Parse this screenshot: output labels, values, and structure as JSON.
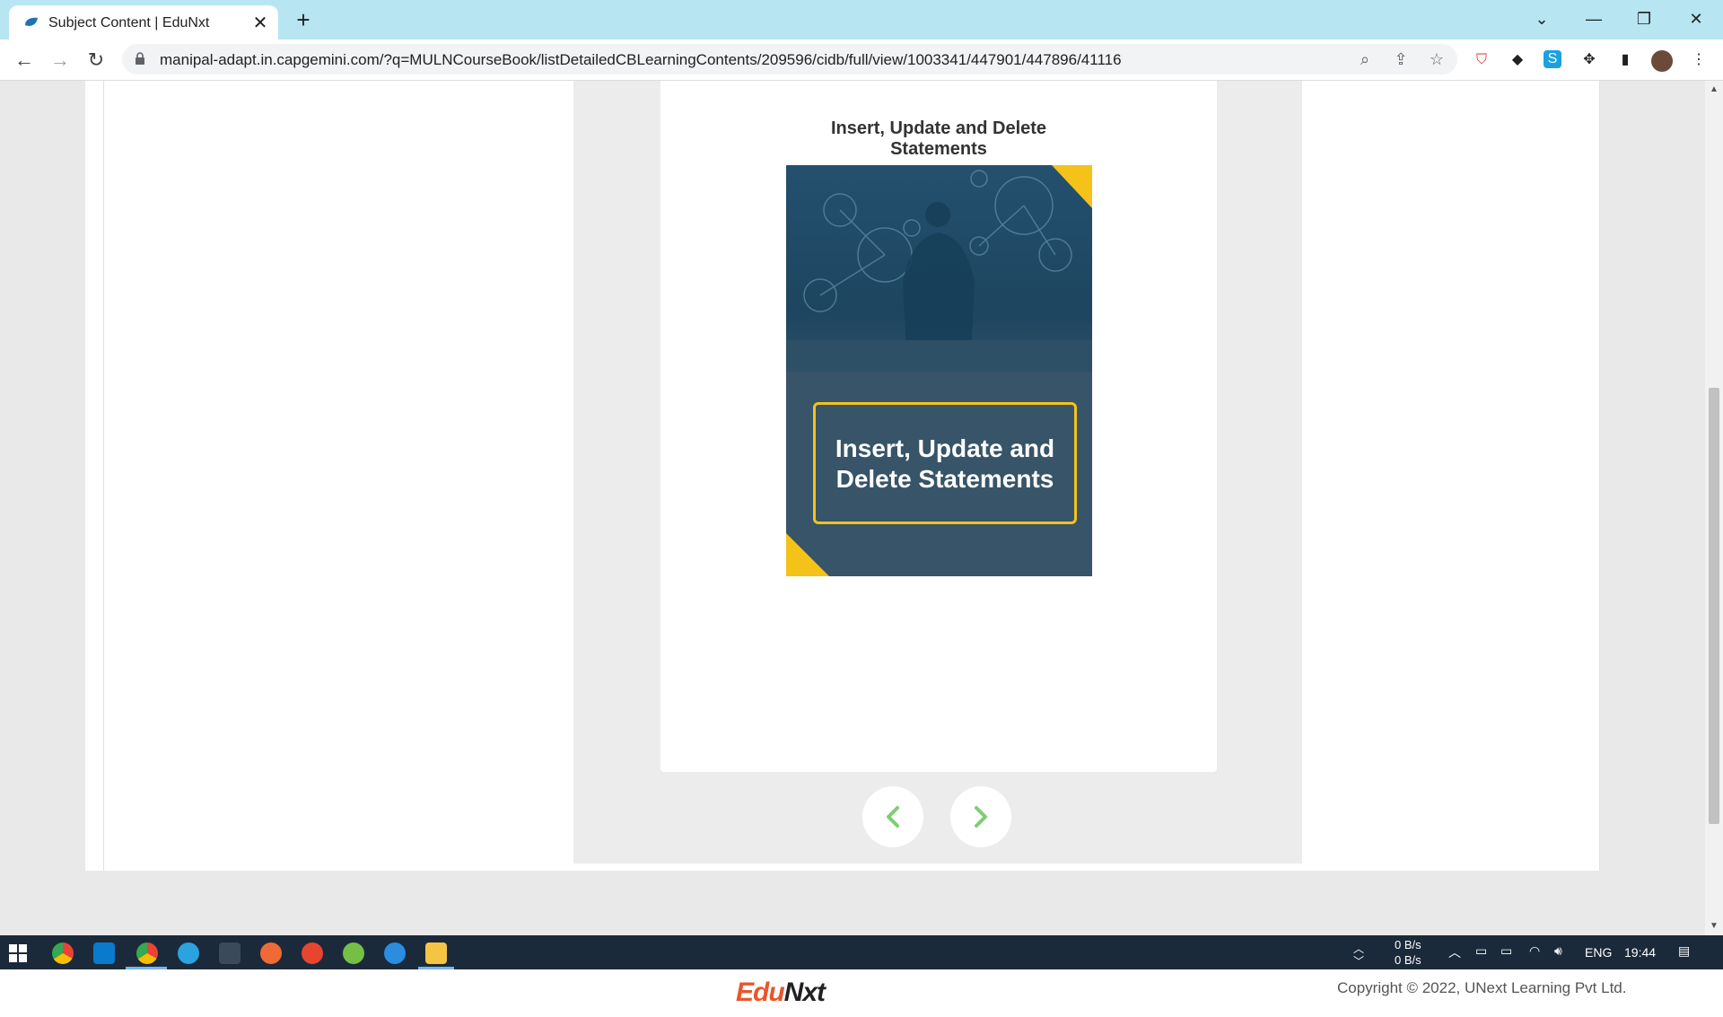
{
  "browser": {
    "tab_title": "Subject Content | EduNxt",
    "url": "manipal-adapt.in.capgemini.com/?q=MULNCourseBook/listDetailedCBLearningContents/209596/cidb/full/view/1003341/447901/447896/41116"
  },
  "content": {
    "title": "Insert, Update and Delete Statements",
    "cover_line1": "Insert, Update and",
    "cover_line2": "Delete Statements",
    "cover_accent": "#f5c21a",
    "nav_arrow_color": "#7dcf6f"
  },
  "footer": {
    "logo_edu": "Edu",
    "logo_nxt": "Nxt",
    "copyright": "Copyright © 2022, UNext Learning Pvt Ltd."
  },
  "taskbar": {
    "net_up": "0 B/s",
    "net_down": "0 B/s",
    "language": "ENG",
    "time": "19:44"
  }
}
